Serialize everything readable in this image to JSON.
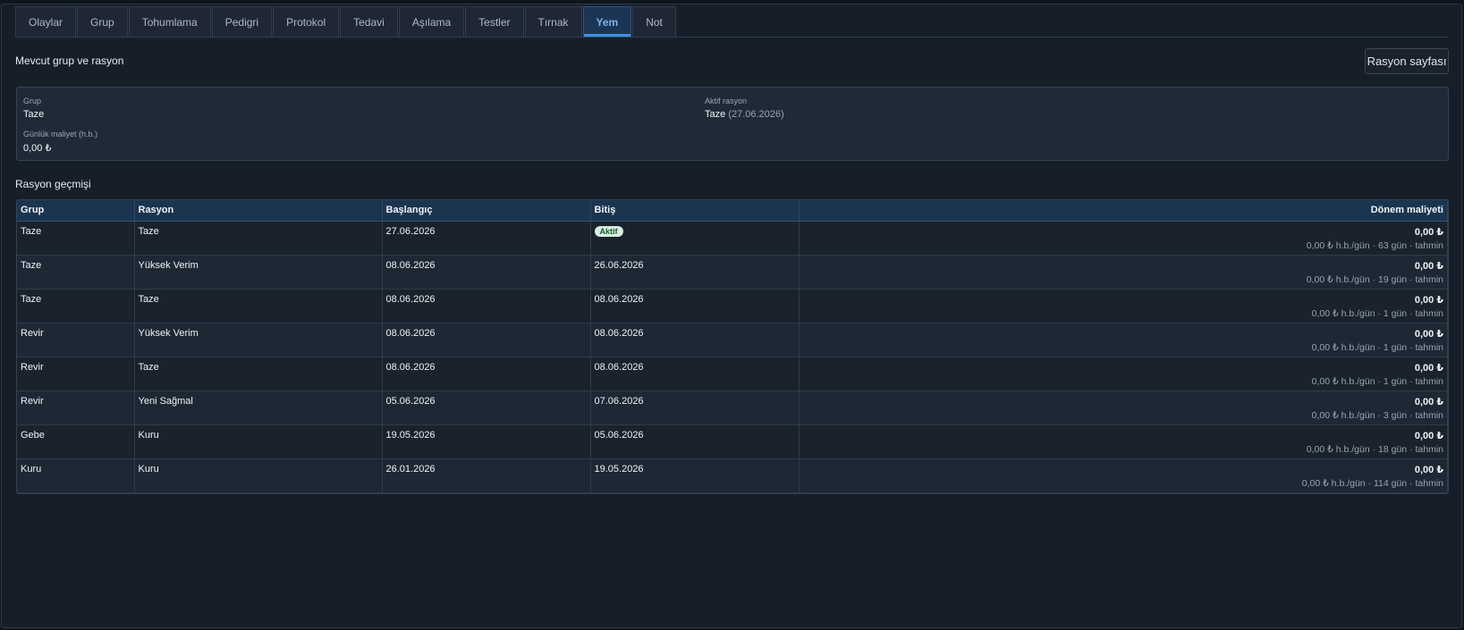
{
  "tabs": [
    {
      "label": "Olaylar",
      "active": false
    },
    {
      "label": "Grup",
      "active": false
    },
    {
      "label": "Tohumlama",
      "active": false
    },
    {
      "label": "Pedigri",
      "active": false
    },
    {
      "label": "Protokol",
      "active": false
    },
    {
      "label": "Tedavi",
      "active": false
    },
    {
      "label": "Aşılama",
      "active": false
    },
    {
      "label": "Testler",
      "active": false
    },
    {
      "label": "Tırnak",
      "active": false
    },
    {
      "label": "Yem",
      "active": true
    },
    {
      "label": "Not",
      "active": false
    }
  ],
  "current": {
    "title": "Mevcut grup ve rasyon",
    "button_label": "Rasyon sayfası",
    "group_label": "Grup",
    "group_value": "Taze",
    "ration_label": "Aktif rasyon",
    "ration_value": "Taze",
    "ration_date": "(27.06.2026)",
    "cost_label": "Günlük maliyet (h.b.)",
    "cost_value": "0,00 ₺"
  },
  "history": {
    "title": "Rasyon geçmişi",
    "columns": [
      "Grup",
      "Rasyon",
      "Başlangıç",
      "Bitiş",
      "Dönem maliyeti"
    ],
    "rows": [
      {
        "group": "Taze",
        "ration": "Taze",
        "start": "27.06.2026",
        "end": "",
        "end_badge": "Aktif",
        "cost": "0,00 ₺",
        "detail": "0,00 ₺ h.b./gün · 63 gün · tahmin"
      },
      {
        "group": "Taze",
        "ration": "Yüksek Verim",
        "start": "08.06.2026",
        "end": "26.06.2026",
        "end_badge": "",
        "cost": "0,00 ₺",
        "detail": "0,00 ₺ h.b./gün · 19 gün · tahmin"
      },
      {
        "group": "Taze",
        "ration": "Taze",
        "start": "08.06.2026",
        "end": "08.06.2026",
        "end_badge": "",
        "cost": "0,00 ₺",
        "detail": "0,00 ₺ h.b./gün · 1 gün · tahmin"
      },
      {
        "group": "Revir",
        "ration": "Yüksek Verim",
        "start": "08.06.2026",
        "end": "08.06.2026",
        "end_badge": "",
        "cost": "0,00 ₺",
        "detail": "0,00 ₺ h.b./gün · 1 gün · tahmin"
      },
      {
        "group": "Revir",
        "ration": "Taze",
        "start": "08.06.2026",
        "end": "08.06.2026",
        "end_badge": "",
        "cost": "0,00 ₺",
        "detail": "0,00 ₺ h.b./gün · 1 gün · tahmin"
      },
      {
        "group": "Revir",
        "ration": "Yeni Sağmal",
        "start": "05.06.2026",
        "end": "07.06.2026",
        "end_badge": "",
        "cost": "0,00 ₺",
        "detail": "0,00 ₺ h.b./gün · 3 gün · tahmin"
      },
      {
        "group": "Gebe",
        "ration": "Kuru",
        "start": "19.05.2026",
        "end": "05.06.2026",
        "end_badge": "",
        "cost": "0,00 ₺",
        "detail": "0,00 ₺ h.b./gün · 18 gün · tahmin"
      },
      {
        "group": "Kuru",
        "ration": "Kuru",
        "start": "26.01.2026",
        "end": "19.05.2026",
        "end_badge": "",
        "cost": "0,00 ₺",
        "detail": "0,00 ₺ h.b./gün · 114 gün · tahmin"
      }
    ]
  }
}
